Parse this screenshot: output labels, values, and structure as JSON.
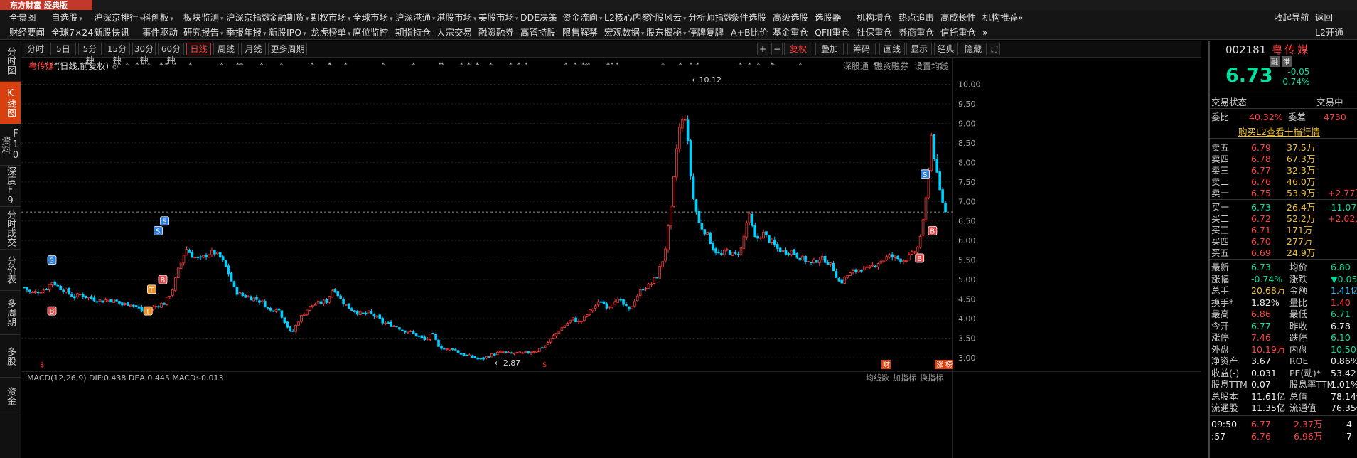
{
  "app": {
    "logo": "东方财富 经典版"
  },
  "menu_row1": [
    {
      "label": "全景图",
      "arrow": false
    },
    {
      "label": "自选股",
      "arrow": true
    },
    {
      "label": "沪深京排行",
      "arrow": true
    },
    {
      "label": "科创板",
      "arrow": true
    },
    {
      "label": "板块监测",
      "arrow": true
    },
    {
      "label": "沪深京指数",
      "arrow": true
    },
    {
      "label": "金融期货",
      "arrow": true
    },
    {
      "label": "期权市场",
      "arrow": true
    },
    {
      "label": "全球市场",
      "arrow": true
    },
    {
      "label": "沪深港通",
      "arrow": true
    },
    {
      "label": "港股市场",
      "arrow": true
    },
    {
      "label": "美股市场",
      "arrow": true
    },
    {
      "label": "DDE决策",
      "arrow": false
    },
    {
      "label": "资金流向",
      "arrow": true
    },
    {
      "label": "L2核心内参",
      "arrow": false
    },
    {
      "label": "个股风云",
      "arrow": true
    },
    {
      "label": "分析师指数",
      "arrow": false
    },
    {
      "label": "条件选股",
      "arrow": false
    },
    {
      "label": "高级选股",
      "arrow": false
    },
    {
      "label": "选股器",
      "arrow": false
    },
    {
      "label": "机构增仓",
      "arrow": false
    },
    {
      "label": "热点追击",
      "arrow": false
    },
    {
      "label": "高成长性",
      "arrow": false
    },
    {
      "label": "机构推荐",
      "arrow": false
    },
    {
      "label": "»",
      "arrow": false
    },
    {
      "label": "收起导航",
      "arrow": false
    },
    {
      "label": "返回",
      "arrow": false
    }
  ],
  "menu_row2": [
    {
      "label": "财经要闻",
      "arrow": false
    },
    {
      "label": "全球7×24",
      "arrow": false
    },
    {
      "label": "新股快讯",
      "arrow": false
    },
    {
      "label": "事件驱动",
      "arrow": false
    },
    {
      "label": "研究报告",
      "arrow": true
    },
    {
      "label": "季报年报",
      "arrow": true
    },
    {
      "label": "新股IPO",
      "arrow": true
    },
    {
      "label": "龙虎榜单",
      "arrow": true
    },
    {
      "label": "席位监控",
      "arrow": false
    },
    {
      "label": "期指持仓",
      "arrow": false
    },
    {
      "label": "大宗交易",
      "arrow": false
    },
    {
      "label": "融资融券",
      "arrow": false
    },
    {
      "label": "高管持股",
      "arrow": false
    },
    {
      "label": "限售解禁",
      "arrow": false
    },
    {
      "label": "宏观数据",
      "arrow": true
    },
    {
      "label": "股东揭秘",
      "arrow": true
    },
    {
      "label": "停牌复牌",
      "arrow": false
    },
    {
      "label": "A+B比价",
      "arrow": false
    },
    {
      "label": "基金重仓",
      "arrow": false
    },
    {
      "label": "QFII重仓",
      "arrow": false
    },
    {
      "label": "社保重仓",
      "arrow": false
    },
    {
      "label": "券商重仓",
      "arrow": false
    },
    {
      "label": "信托重仓",
      "arrow": false
    },
    {
      "label": "»",
      "arrow": false
    },
    {
      "label": "L2开通",
      "arrow": false
    }
  ],
  "periods": [
    "分时",
    "5日",
    "5分钟",
    "15分钟",
    "30分钟",
    "60分钟",
    "日线",
    "周线",
    "月线",
    "更多周期"
  ],
  "active_period": "日线",
  "chart_tools": [
    "+",
    "−",
    "复权",
    "叠加",
    "筹码",
    "画线",
    "显示",
    "经典",
    "隐藏"
  ],
  "left_tabs": [
    "分时图",
    "K线图",
    "F10资料",
    "深度F9",
    "分时成交",
    "分价表",
    "多周期",
    "多股",
    "资金"
  ],
  "chart_header": {
    "stock": "粤传媒",
    "mode": "(日线,前复权)",
    "links": [
      "深股通",
      "融资融券",
      "设置均线"
    ]
  },
  "chart_data": {
    "type": "candlestick",
    "ylim": [
      2.8,
      10.3
    ],
    "yticks": [
      "10.00",
      "9.50",
      "9.00",
      "8.50",
      "8.00",
      "7.50",
      "7.00",
      "6.50",
      "6.00",
      "5.50",
      "5.00",
      "4.50",
      "4.00",
      "3.50",
      "3.00"
    ],
    "last_close": 6.73,
    "max_label": "10.12",
    "min_label": "2.87",
    "close_path": [
      4.8,
      4.65,
      4.7,
      4.75,
      4.95,
      4.8,
      4.7,
      4.55,
      4.62,
      4.55,
      4.5,
      4.45,
      4.5,
      4.45,
      4.35,
      4.4,
      4.3,
      4.15,
      4.25,
      4.35,
      4.4,
      4.7,
      5.3,
      5.8,
      5.6,
      5.5,
      5.65,
      5.7,
      5.55,
      5.2,
      4.7,
      4.6,
      4.55,
      4.5,
      4.4,
      4.2,
      4.3,
      3.95,
      3.6,
      3.95,
      4.2,
      4.35,
      4.4,
      4.45,
      4.8,
      4.5,
      4.3,
      4.2,
      4.1,
      4.15,
      4.05,
      3.9,
      3.85,
      3.8,
      3.7,
      3.65,
      3.55,
      3.45,
      3.6,
      3.3,
      3.2,
      3.25,
      3.1,
      3.05,
      3.0,
      2.95,
      3.05,
      3.1,
      3.15,
      3.1,
      3.12,
      3.1,
      3.15,
      3.2,
      3.3,
      3.5,
      3.7,
      3.85,
      4.0,
      3.9,
      4.1,
      4.3,
      4.45,
      4.3,
      4.5,
      4.4,
      4.2,
      4.55,
      4.8,
      4.85,
      5.1,
      5.6,
      6.8,
      8.8,
      9.2,
      7.2,
      6.4,
      6.2,
      5.8,
      5.6,
      5.75,
      5.6,
      5.8,
      6.7,
      6.0,
      6.2,
      6.0,
      5.8,
      5.7,
      5.75,
      5.6,
      5.5,
      5.4,
      5.55,
      5.5,
      5.3,
      4.9,
      5.1,
      5.2,
      5.3,
      5.25,
      5.4,
      5.5,
      5.6,
      5.55,
      5.5,
      5.6,
      5.8,
      6.6,
      8.7,
      7.4,
      6.73
    ],
    "markers": [
      {
        "label": "S",
        "color": "#2e7de0",
        "at": 0.03,
        "price": 5.5
      },
      {
        "label": "B",
        "color": "#e04a4a",
        "at": 0.03,
        "price": 4.2
      },
      {
        "label": "S",
        "color": "#2e7de0",
        "at": 0.145,
        "price": 6.25
      },
      {
        "label": "S",
        "color": "#2e7de0",
        "at": 0.152,
        "price": 6.5
      },
      {
        "label": "B",
        "color": "#e04a4a",
        "at": 0.15,
        "price": 5.0
      },
      {
        "label": "T",
        "color": "#f09020",
        "at": 0.138,
        "price": 4.75
      },
      {
        "label": "T",
        "color": "#f09020",
        "at": 0.134,
        "price": 4.2
      },
      {
        "label": "S",
        "color": "#2e7de0",
        "at": 0.975,
        "price": 7.7
      },
      {
        "label": "B",
        "color": "#e04a4a",
        "at": 0.983,
        "price": 6.25
      },
      {
        "label": "B",
        "color": "#e04a4a",
        "at": 0.969,
        "price": 5.55
      }
    ],
    "bottom_labels": [
      "$",
      "$",
      "财",
      "涨",
      "榜"
    ],
    "indicator_text": "MACD(12,26,9) DIF:0.438 DEA:0.445 MACD:-0.013",
    "bottom_right": [
      "均线数",
      "加指标",
      "换指标"
    ]
  },
  "quote": {
    "code": "002181",
    "name": "粤传媒",
    "tags": [
      "融",
      "港"
    ],
    "price": "6.73",
    "change": "-0.05",
    "change_pct": "-0.74%",
    "status_label": "交易状态",
    "status_value": "交易中",
    "weibi_label": "委比",
    "weibi_value": "40.32%",
    "weicha_label": "委差",
    "weicha_value": "4730",
    "l2_link": "购买L2查看十档行情",
    "asks": [
      {
        "label": "卖五",
        "price": "6.79",
        "vol": "37.5万",
        "extra": ""
      },
      {
        "label": "卖四",
        "price": "6.78",
        "vol": "67.3万",
        "extra": ""
      },
      {
        "label": "卖三",
        "price": "6.77",
        "vol": "32.3万",
        "extra": ""
      },
      {
        "label": "卖二",
        "price": "6.76",
        "vol": "46.0万",
        "extra": ""
      },
      {
        "label": "卖一",
        "price": "6.75",
        "vol": "53.9万",
        "extra": "+2.77万"
      }
    ],
    "bids": [
      {
        "label": "买一",
        "price": "6.73",
        "vol": "26.4万",
        "extra": "-11.07"
      },
      {
        "label": "买二",
        "price": "6.72",
        "vol": "52.2万",
        "extra": "+2.02万"
      },
      {
        "label": "买三",
        "price": "6.71",
        "vol": "171万",
        "extra": ""
      },
      {
        "label": "买四",
        "price": "6.70",
        "vol": "277万",
        "extra": ""
      },
      {
        "label": "买五",
        "price": "6.69",
        "vol": "24.9万",
        "extra": ""
      }
    ],
    "stats": [
      [
        "最新",
        "6.73",
        "均价",
        "6.80"
      ],
      [
        "涨幅",
        "-0.74%",
        "涨跌",
        "▼0.05"
      ],
      [
        "总手",
        "20.68万",
        "金额",
        "1.41亿"
      ],
      [
        "换手*",
        "1.82%",
        "量比",
        "1.40"
      ],
      [
        "最高",
        "6.86",
        "最低",
        "6.71"
      ],
      [
        "今开",
        "6.77",
        "昨收",
        "6.78"
      ],
      [
        "涨停",
        "7.46",
        "跌停",
        "6.10"
      ],
      [
        "外盘",
        "10.19万",
        "内盘",
        "10.50万"
      ],
      [
        "净资产",
        "3.67",
        "ROE",
        "0.86%"
      ],
      [
        "收益(-)",
        "0.031",
        "PE(动)*",
        "53.42"
      ],
      [
        "股息TTM",
        "0.07",
        "股息率TTM",
        "1.01%"
      ],
      [
        "总股本",
        "11.61亿",
        "总值",
        "78.14亿"
      ],
      [
        "流通股",
        "11.35亿",
        "流通值",
        "76.35亿"
      ]
    ],
    "ticks": [
      [
        "09:50",
        "6.77",
        "2.37万",
        "4"
      ],
      [
        ":57",
        "6.76",
        "6.96万",
        "7"
      ]
    ]
  }
}
